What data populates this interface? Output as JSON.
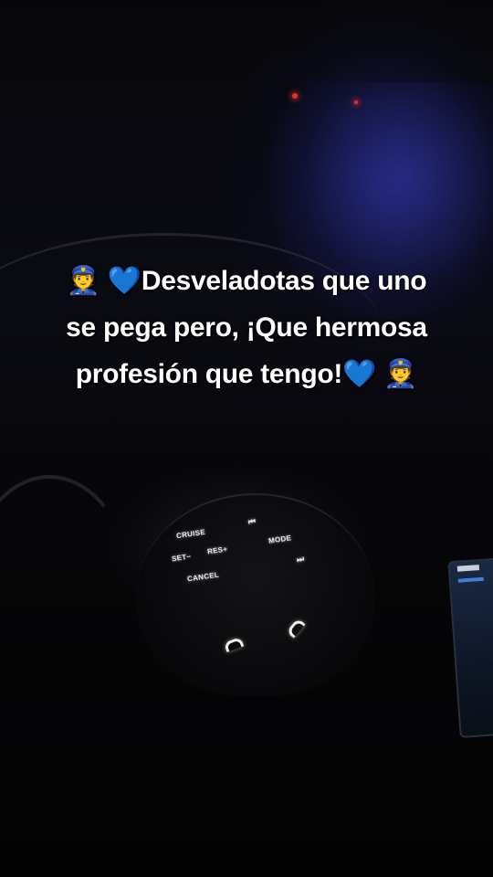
{
  "caption": {
    "line1_icon": "👮",
    "line1_heart": "💙",
    "line1_text": "Desveladotas que uno",
    "line2_text": "se pega pero, ¡Que hermosa",
    "line3_text": "profesión que tengo!",
    "line3_heart": "💙",
    "line3_icon": "👮"
  },
  "steering_buttons": {
    "cruise": "CRUISE",
    "set": "SET−",
    "res": "RES+",
    "cancel": "CANCEL",
    "mode": "MODE",
    "prev": "⏮",
    "next": "⏭"
  },
  "colors": {
    "text": "#ffffff",
    "heart": "#2f7fe0",
    "ambient_blue": "#2a2f9a"
  }
}
